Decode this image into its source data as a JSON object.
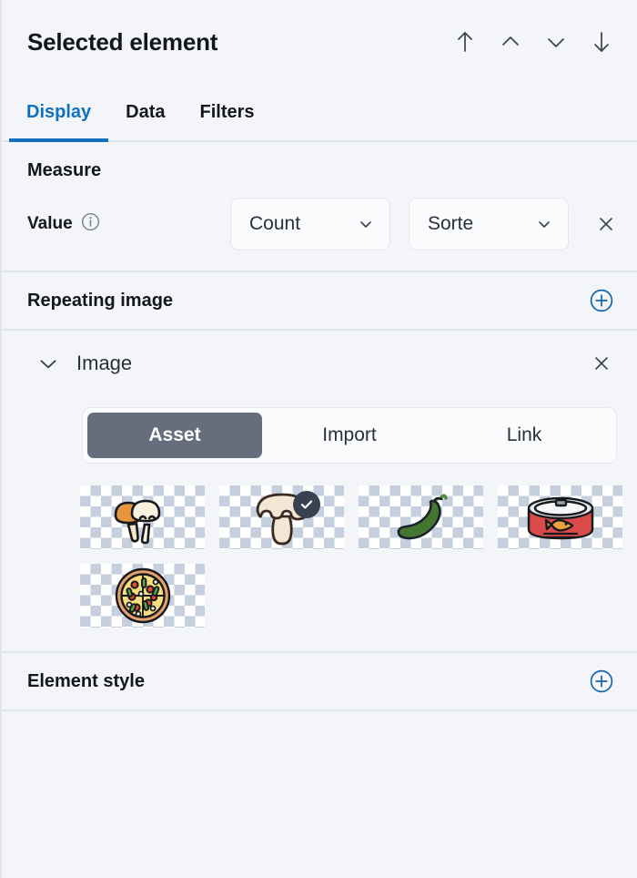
{
  "header": {
    "title": "Selected element",
    "actions": [
      {
        "name": "move-to-top-icon",
        "icon": "arrow-up"
      },
      {
        "name": "move-up-icon",
        "icon": "chevron-up"
      },
      {
        "name": "move-down-icon",
        "icon": "chevron-down"
      },
      {
        "name": "move-to-bottom-icon",
        "icon": "arrow-down"
      }
    ]
  },
  "tabs": [
    {
      "label": "Display",
      "active": true
    },
    {
      "label": "Data",
      "active": false
    },
    {
      "label": "Filters",
      "active": false
    }
  ],
  "measure": {
    "title": "Measure",
    "value_label": "Value",
    "info_icon": "info-icon",
    "aggregation": {
      "value": "Count",
      "caret": "chevron-down-icon"
    },
    "field": {
      "value": "Sorte",
      "caret": "chevron-down-icon"
    },
    "remove_icon": "close-icon"
  },
  "repeating_image": {
    "title": "Repeating image",
    "add_icon": "plus-circle-icon",
    "group": {
      "label": "Image",
      "collapse_icon": "chevron-down-icon",
      "remove_icon": "close-icon",
      "source_tabs": [
        {
          "label": "Asset",
          "active": true
        },
        {
          "label": "Import",
          "active": false
        },
        {
          "label": "Link",
          "active": false
        }
      ],
      "assets": [
        {
          "name": "asset-mushrooms-pair",
          "selected": false
        },
        {
          "name": "asset-mushroom-single",
          "selected": true
        },
        {
          "name": "asset-chili-pepper",
          "selected": false
        },
        {
          "name": "asset-fish-can",
          "selected": false
        },
        {
          "name": "asset-pizza",
          "selected": false
        }
      ]
    }
  },
  "element_style": {
    "title": "Element style",
    "add_icon": "plus-circle-icon"
  },
  "colors": {
    "background": "#f3f5f9",
    "divider": "#dfe4ed",
    "accent_blue": "#1171bd",
    "text_primary": "#13161c",
    "segmented_active": "#666e7e",
    "check_badge": "#39404f",
    "checker": "#c6cfde"
  }
}
